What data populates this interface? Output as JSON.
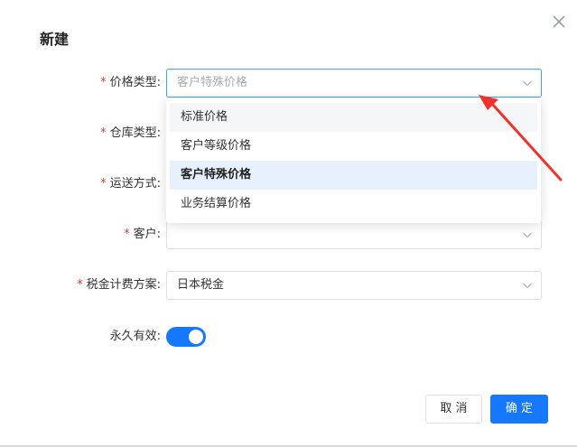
{
  "dialog": {
    "title": "新建"
  },
  "form": {
    "price_type": {
      "label": "价格类型:",
      "required": "*",
      "placeholder": "客户特殊价格",
      "value": ""
    },
    "warehouse_type": {
      "label": "仓库类型:",
      "required": "*"
    },
    "shipping_method": {
      "label": "运送方式:",
      "required": "*"
    },
    "customer": {
      "label": "客户:",
      "required": "*",
      "value": ""
    },
    "tax_plan": {
      "label": "税金计费方案:",
      "required": "*",
      "value": "日本税金"
    },
    "permanent": {
      "label": "永久有效:",
      "enabled": true
    }
  },
  "dropdown": {
    "options": [
      {
        "label": "标准价格",
        "state": "hover"
      },
      {
        "label": "客户等级价格",
        "state": "normal"
      },
      {
        "label": "客户特殊价格",
        "state": "selected"
      },
      {
        "label": "业务结算价格",
        "state": "normal"
      }
    ]
  },
  "buttons": {
    "cancel": "取 消",
    "confirm": "确 定"
  },
  "colors": {
    "primary": "#1677ff",
    "required": "#e0393e",
    "annotation_arrow": "#f0322a",
    "focus_border": "#409eff"
  },
  "icons": {
    "close": "close-icon",
    "chevron": "chevron-down-icon",
    "annotation": "red-arrow-annotation"
  }
}
